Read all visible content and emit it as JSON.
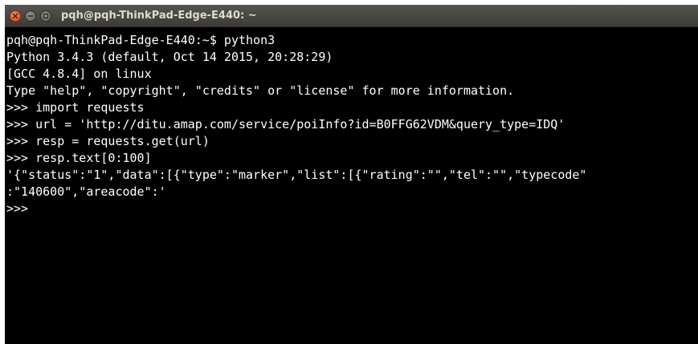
{
  "window": {
    "title": "pqh@pqh-ThinkPad-Edge-E440: ~"
  },
  "terminal": {
    "lines": [
      "pqh@pqh-ThinkPad-Edge-E440:~$ python3",
      "Python 3.4.3 (default, Oct 14 2015, 20:28:29)",
      "[GCC 4.8.4] on linux",
      "Type \"help\", \"copyright\", \"credits\" or \"license\" for more information.",
      ">>> import requests",
      ">>> url = 'http://ditu.amap.com/service/poiInfo?id=B0FFG62VDM&query_type=IDQ'",
      ">>> resp = requests.get(url)",
      ">>> resp.text[0:100]",
      "'{\"status\":\"1\",\"data\":[{\"type\":\"marker\",\"list\":[{\"rating\":\"\",\"tel\":\"\",\"typecode\"",
      ":\"140600\",\"areacode\":'",
      ">>> "
    ]
  },
  "colors": {
    "background": "#000000",
    "text": "#ffffff",
    "titlebar": "#3c3b37",
    "close_button": "#df4a16"
  }
}
